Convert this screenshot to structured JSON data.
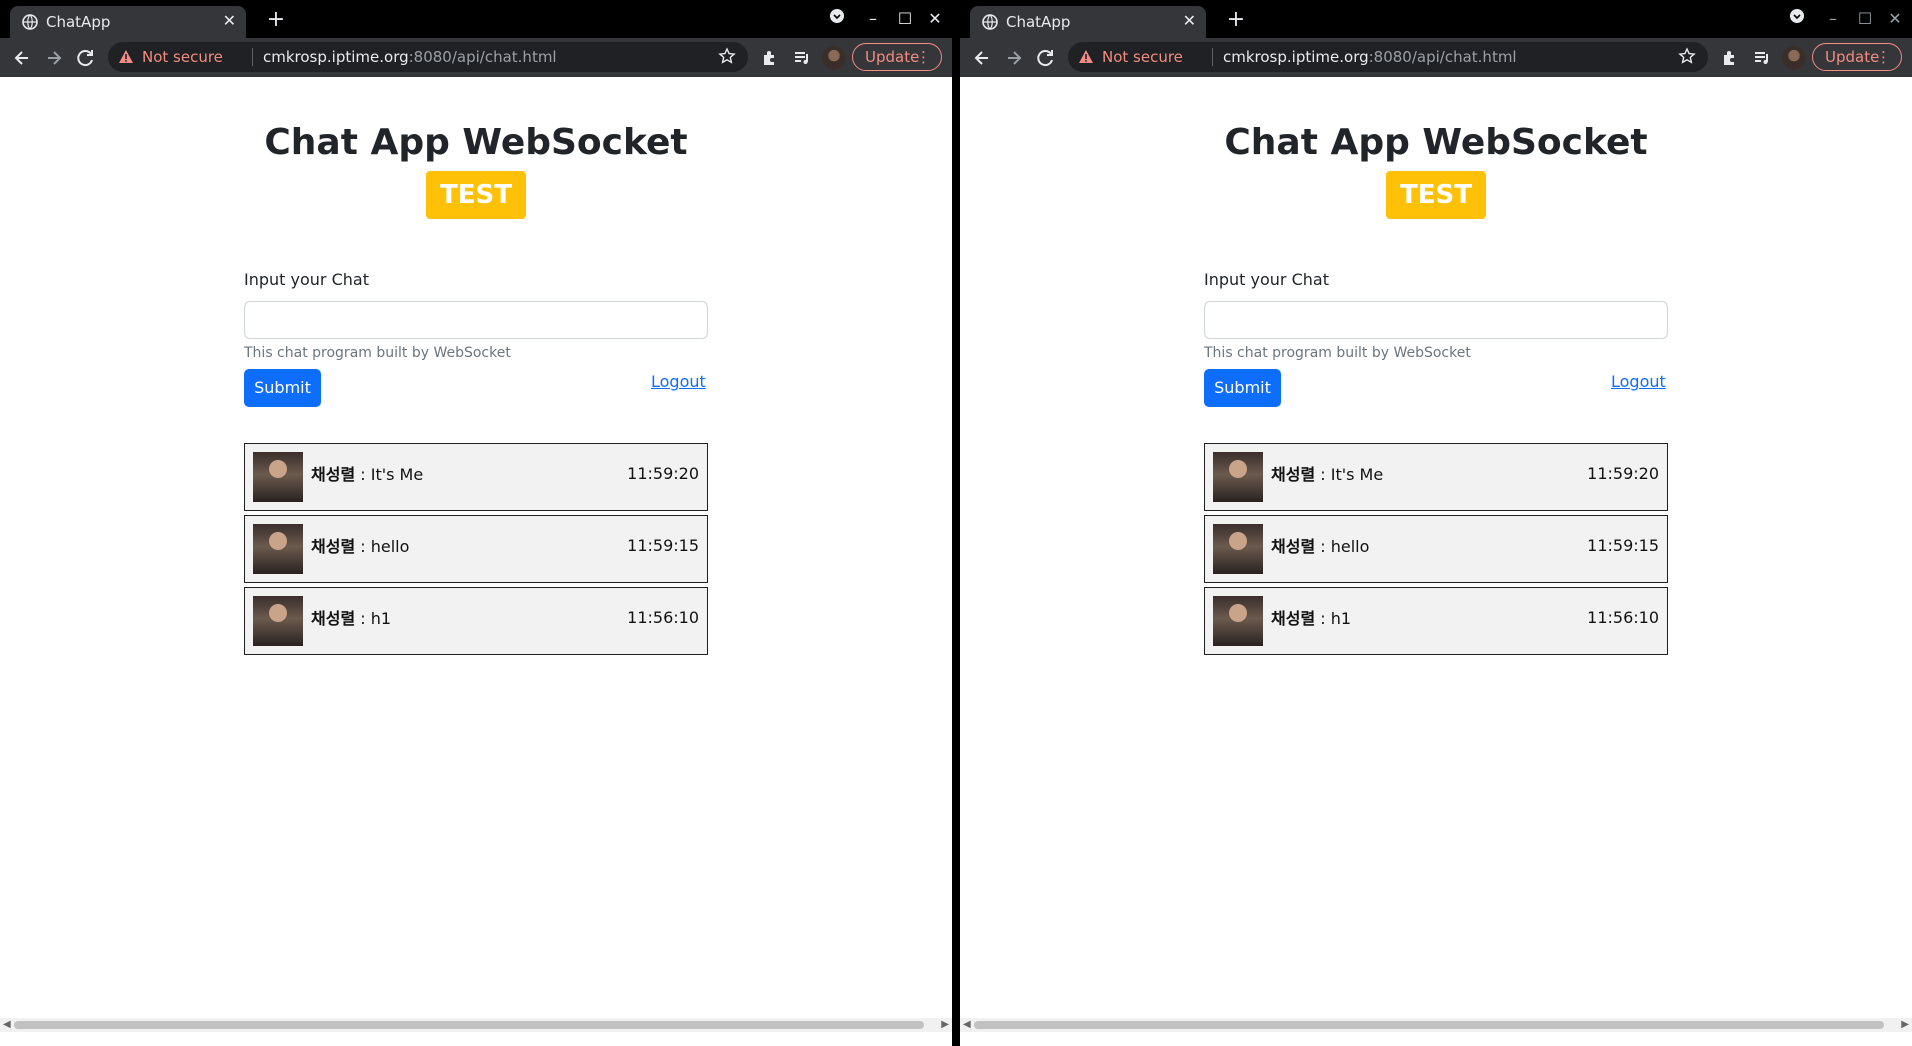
{
  "windows": [
    {
      "tab": {
        "title": "ChatApp"
      },
      "omnibox": {
        "security": "Not secure",
        "host": "cmkrosp.iptime.org",
        "path": ":8080/api/chat.html"
      },
      "update_label": "Update",
      "page": {
        "title": "Chat App WebSocket",
        "badge": "TEST",
        "input_label": "Input your Chat",
        "input_value": "",
        "help_text": "This chat program built by WebSocket",
        "submit_label": "Submit",
        "logout_label": "Logout",
        "messages": [
          {
            "user": "채성렬",
            "text": " : It's Me",
            "time": "11:59:20"
          },
          {
            "user": "채성렬",
            "text": " : hello",
            "time": "11:59:15"
          },
          {
            "user": "채성렬",
            "text": " : h1",
            "time": "11:56:10"
          }
        ]
      }
    },
    {
      "tab": {
        "title": "ChatApp"
      },
      "omnibox": {
        "security": "Not secure",
        "host": "cmkrosp.iptime.org",
        "path": ":8080/api/chat.html"
      },
      "update_label": "Update",
      "page": {
        "title": "Chat App WebSocket",
        "badge": "TEST",
        "input_label": "Input your Chat",
        "input_value": "",
        "help_text": "This chat program built by WebSocket",
        "submit_label": "Submit",
        "logout_label": "Logout",
        "messages": [
          {
            "user": "채성렬",
            "text": " : It's Me",
            "time": "11:59:20"
          },
          {
            "user": "채성렬",
            "text": " : hello",
            "time": "11:59:15"
          },
          {
            "user": "채성렬",
            "text": " : h1",
            "time": "11:56:10"
          }
        ]
      }
    }
  ],
  "icons": {
    "tab_favicon": "globe-icon",
    "tab_close": "close-icon",
    "new_tab": "plus-icon",
    "back": "back-arrow-icon",
    "forward": "forward-arrow-icon",
    "reload": "reload-icon",
    "warning": "warning-icon",
    "bookmark": "star-icon",
    "extensions": "puzzle-icon",
    "media": "media-control-icon",
    "menu": "kebab-menu-icon"
  },
  "colors": {
    "primary": "#0d6efd",
    "badge": "#ffc107",
    "not_secure": "#f28b82",
    "chrome_dark": "#35363a"
  }
}
